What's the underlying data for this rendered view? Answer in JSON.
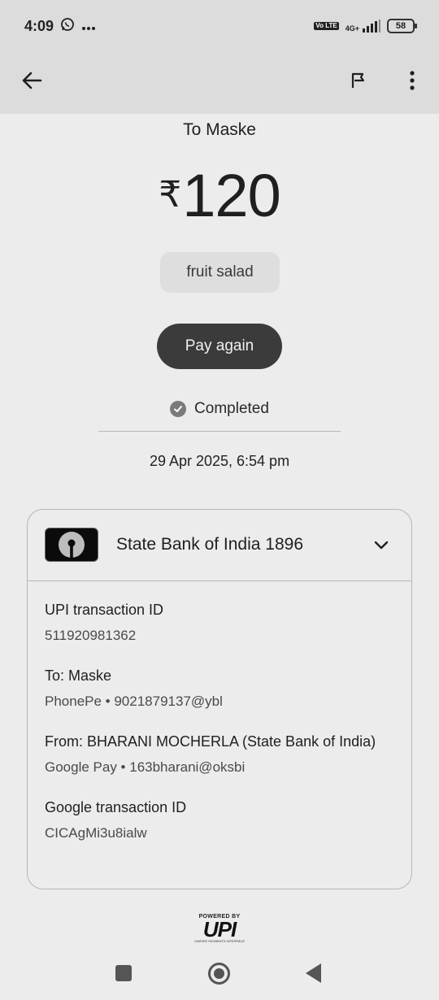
{
  "status_bar": {
    "time": "4:09",
    "network": "4G+",
    "volte": "Vo LTE",
    "battery": "58",
    "notification_icons": [
      "whatsapp-icon",
      "more-dots-icon"
    ]
  },
  "app_bar": {
    "back_icon": "arrow-left-icon",
    "flag_icon": "flag-icon",
    "more_icon": "more-vert-icon"
  },
  "payment": {
    "to_label": "To Maske",
    "currency_symbol": "₹",
    "amount": "120",
    "note": "fruit salad",
    "pay_again_label": "Pay again",
    "status": "Completed",
    "datetime": "29 Apr 2025, 6:54 pm"
  },
  "card": {
    "bank_name": "State Bank of India 1896",
    "fields": [
      {
        "label": "UPI transaction ID",
        "value": "511920981362"
      },
      {
        "label": "To: Maske",
        "value": "PhonePe • 9021879137@ybl"
      },
      {
        "label": "From: BHARANI  MOCHERLA (State Bank of India)",
        "value": "Google Pay • 163bharani@oksbi"
      },
      {
        "label": "Google transaction ID",
        "value": "CICAgMi3u8ialw"
      }
    ]
  },
  "footer": {
    "powered_by": "POWERED BY",
    "upi": "UPI",
    "upi_sub": "UNIFIED PAYMENTS INTERFACE"
  },
  "colors": {
    "background": "#ececec",
    "app_bar": "#dcdcdc",
    "button_dark": "#3b3b3b",
    "chip": "#dedede"
  }
}
